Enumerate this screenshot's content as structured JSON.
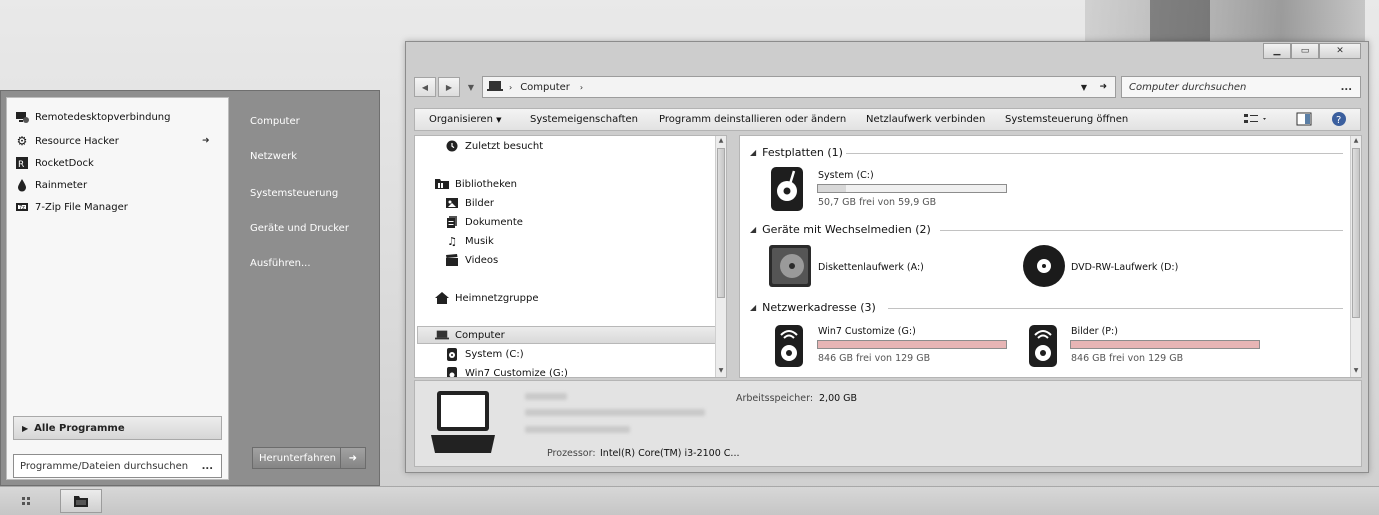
{
  "start_menu": {
    "pinned": [
      {
        "label": "Remotedesktopverbindung",
        "icon": "remote-desktop-icon"
      },
      {
        "label": "Resource Hacker",
        "icon": "gear-icon"
      },
      {
        "label": "RocketDock",
        "icon": "rocketdock-icon"
      },
      {
        "label": "Rainmeter",
        "icon": "drop-icon"
      },
      {
        "label": "7-Zip File Manager",
        "icon": "archive-icon"
      }
    ],
    "all_programs": "Alle Programme",
    "search_placeholder": "Programme/Dateien durchsuchen",
    "search_dots": "...",
    "right_links": [
      "Computer",
      "Netzwerk",
      "Systemsteuerung",
      "Geräte und Drucker",
      "Ausführen..."
    ],
    "shutdown": "Herunterfahren"
  },
  "explorer": {
    "address": "Computer",
    "search_placeholder": "Computer durchsuchen",
    "search_dots": "...",
    "toolbar": {
      "organize": "Organisieren",
      "items": [
        "Systemeigenschaften",
        "Programm deinstallieren oder ändern",
        "Netzlaufwerk verbinden",
        "Systemsteuerung öffnen"
      ]
    },
    "nav": {
      "recent": "Zuletzt besucht",
      "libraries": "Bibliotheken",
      "lib_items": [
        "Bilder",
        "Dokumente",
        "Musik",
        "Videos"
      ],
      "homegroup": "Heimnetzgruppe",
      "computer": "Computer",
      "drives": [
        "System (C:)",
        "Win7 Customize (G:)"
      ]
    },
    "groups": [
      {
        "title": "Festplatten (1)"
      },
      {
        "title": "Geräte mit Wechselmedien (2)"
      },
      {
        "title": "Netzwerkadresse (3)"
      }
    ],
    "hard_disk": {
      "name": "System (C:)",
      "free": "50,7 GB frei von 59,9 GB",
      "used_fraction": 0.15
    },
    "removable": [
      "Diskettenlaufwerk (A:)",
      "DVD-RW-Laufwerk (D:)"
    ],
    "network": [
      {
        "name": "Win7 Customize (G:)",
        "free": "846 GB frei von 129 GB",
        "used_fraction": 1.0
      },
      {
        "name": "Bilder (P:)",
        "free": "846 GB frei von 129 GB",
        "used_fraction": 1.0
      }
    ],
    "details": {
      "ram_label": "Arbeitsspeicher:",
      "ram_value": "2,00 GB",
      "cpu_label": "Prozessor:",
      "cpu_value": "Intel(R) Core(TM) i3-2100 C..."
    }
  },
  "colors": {
    "bar_normal": "#d8d8d8",
    "bar_full": "#e7b5b5"
  }
}
